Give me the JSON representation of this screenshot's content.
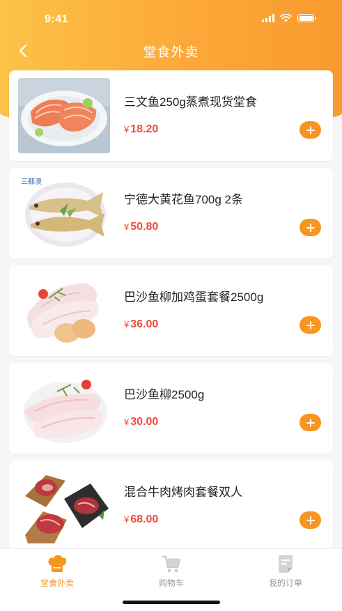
{
  "status": {
    "time": "9:41"
  },
  "header": {
    "title": "堂食外卖",
    "back_icon": "chevron-left-icon"
  },
  "products": [
    {
      "name": "三文鱼250g蒸煮现货堂食",
      "currency": "¥",
      "price": "18.20",
      "image": "salmon-steak"
    },
    {
      "name": "宁德大黄花鱼700g 2条",
      "currency": "¥",
      "price": "50.80",
      "image": "yellow-croaker",
      "image_badge": "三都澳"
    },
    {
      "name": "巴沙鱼柳加鸡蛋套餐2500g",
      "currency": "¥",
      "price": "36.00",
      "image": "basa-fillet-eggs"
    },
    {
      "name": "巴沙鱼柳2500g",
      "currency": "¥",
      "price": "30.00",
      "image": "basa-fillet"
    },
    {
      "name": "混合牛肉烤肉套餐双人",
      "currency": "¥",
      "price": "68.00",
      "image": "beef-steaks"
    }
  ],
  "tabs": [
    {
      "label": "堂食外卖",
      "icon": "chef-hat-icon",
      "active": true
    },
    {
      "label": "购物车",
      "icon": "cart-icon",
      "active": false
    },
    {
      "label": "我的订单",
      "icon": "order-doc-icon",
      "active": false
    }
  ],
  "colors": {
    "accent": "#f7951f",
    "price": "#f04a3a",
    "header_start": "#fbc248",
    "header_end": "#f99a2e"
  }
}
